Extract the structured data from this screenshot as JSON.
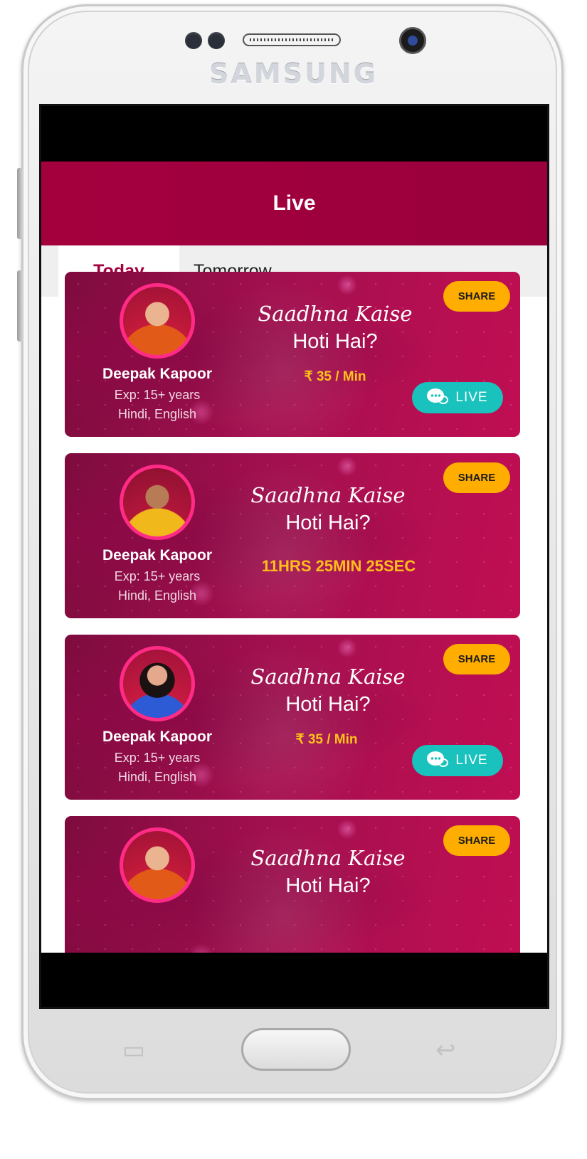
{
  "device": {
    "brand": "SAMSUNG"
  },
  "header": {
    "title": "Live"
  },
  "tabs": [
    {
      "label": "Today",
      "active": true
    },
    {
      "label": "Tomorrow",
      "active": false
    }
  ],
  "colors": {
    "primary": "#a4003e",
    "share": "#ffae00",
    "live": "#19c2bd",
    "price": "#ffc21a"
  },
  "cards": [
    {
      "name": "Deepak Kapoor",
      "experience": "Exp: 15+ years",
      "languages": "Hindi, English",
      "topic_line1": "Saadhna Kaise",
      "topic_line2": "Hoti Hai?",
      "price": "₹ 35 / Min",
      "share_label": "SHARE",
      "live_label": "LIVE",
      "icon": "chat-support-icon"
    },
    {
      "name": "Deepak Kapoor",
      "experience": "Exp: 15+ years",
      "languages": "Hindi, English",
      "topic_line1": "Saadhna Kaise",
      "topic_line2": "Hoti Hai?",
      "countdown": "11HRS 25MIN 25SEC",
      "share_label": "SHARE"
    },
    {
      "name": "Deepak Kapoor",
      "experience": "Exp: 15+ years",
      "languages": "Hindi, English",
      "topic_line1": "Saadhna Kaise",
      "topic_line2": "Hoti Hai?",
      "price": "₹ 35 / Min",
      "share_label": "SHARE",
      "live_label": "LIVE",
      "icon": "chat-support-icon"
    },
    {
      "topic_line1": "Saadhna Kaise",
      "topic_line2": "Hoti Hai?",
      "share_label": "SHARE"
    }
  ]
}
